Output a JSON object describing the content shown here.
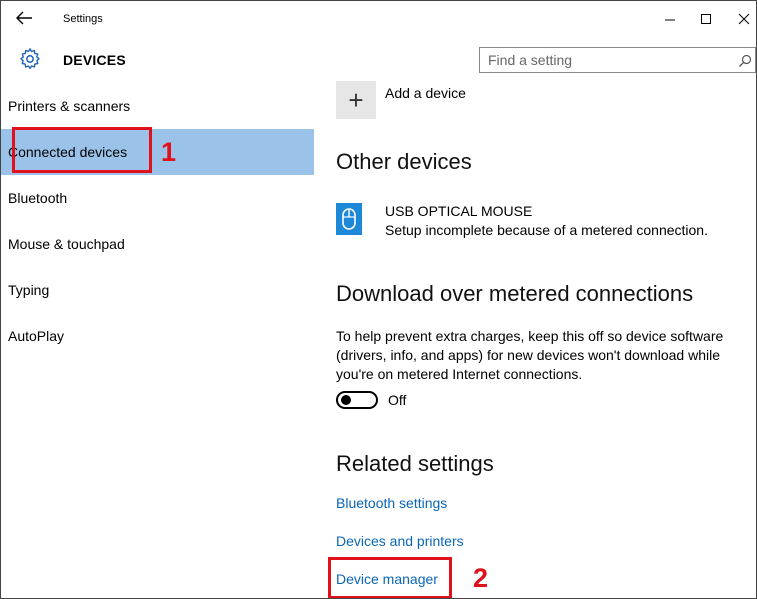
{
  "window": {
    "title": "Settings",
    "minimize_glyph": "–",
    "maximize_glyph": "☐",
    "close_glyph": "✕"
  },
  "header": {
    "section_title": "DEVICES",
    "search_placeholder": "Find a setting",
    "search_value": ""
  },
  "sidebar": {
    "items": [
      {
        "label": "Printers & scanners",
        "selected": false
      },
      {
        "label": "Connected devices",
        "selected": true
      },
      {
        "label": "Bluetooth",
        "selected": false
      },
      {
        "label": "Mouse & touchpad",
        "selected": false
      },
      {
        "label": "Typing",
        "selected": false
      },
      {
        "label": "AutoPlay",
        "selected": false
      }
    ]
  },
  "main": {
    "add_device_symbol": "+",
    "add_device_label": "Add a device",
    "other_devices_heading": "Other devices",
    "device": {
      "name": "USB OPTICAL MOUSE",
      "status": "Setup incomplete because of a metered connection."
    },
    "metered_heading": "Download over metered connections",
    "metered_description": "To help prevent extra charges, keep this off so device software (drivers, info, and apps) for new devices won't download while you're on metered Internet connections.",
    "toggle": {
      "state_label": "Off",
      "on": false
    },
    "related_heading": "Related settings",
    "related_links": [
      {
        "label": "Bluetooth settings"
      },
      {
        "label": "Devices and printers"
      },
      {
        "label": "Device manager"
      }
    ]
  },
  "annotations": {
    "marker_1": "1",
    "marker_2": "2",
    "marker_color": "#e0111a"
  },
  "colors": {
    "selected_nav": "#9bc3ea",
    "link": "#0a66b7",
    "device_icon": "#1e88d8"
  },
  "icons": {
    "back": "back-arrow-icon",
    "settings": "gear-icon",
    "search": "search-icon",
    "device": "mouse-icon"
  }
}
